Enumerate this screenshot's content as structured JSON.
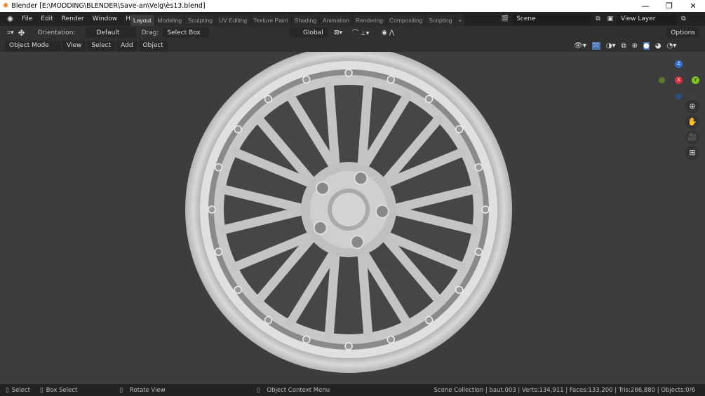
{
  "window": {
    "title": "Blender [E:\\MODDING\\BLENDER\\Save-an\\Velg\\ès13.blend]",
    "minimize": "—",
    "restore": "❐",
    "close": "✕"
  },
  "menu": [
    "File",
    "Edit",
    "Render",
    "Window",
    "Help"
  ],
  "workspaces": [
    "Layout",
    "Modeling",
    "Sculpting",
    "UV Editing",
    "Texture Paint",
    "Shading",
    "Animation",
    "Rendering",
    "Compositing",
    "Scripting"
  ],
  "add_workspace": "+",
  "scene": "Scene",
  "view_layer": "View Layer",
  "tool_header": {
    "orientation_label": "Orientation:",
    "orientation": "Default",
    "drag_label": "Drag:",
    "drag": "Select Box",
    "transform": "Global",
    "options": "Options"
  },
  "view_header": {
    "mode": "Object Mode",
    "menus": [
      "View",
      "Select",
      "Add",
      "Object"
    ]
  },
  "gizmo": {
    "z": "Z",
    "x": "X",
    "y": "Y"
  },
  "status": {
    "select": "Select",
    "box_select": "Box Select",
    "rotate": "Rotate View",
    "context": "Object Context Menu",
    "stats": "Scene Collection | baut.003 | Verts:134,911 | Faces:133,200 | Tris:266,880 | Objects:0/6"
  }
}
